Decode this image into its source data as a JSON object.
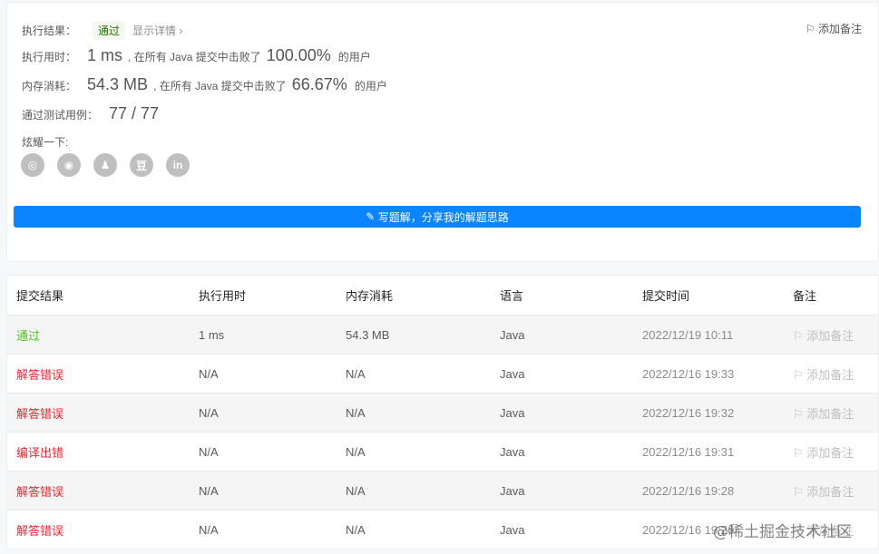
{
  "result": {
    "label": "执行结果：",
    "status": "通过",
    "detail": "显示详情 ›",
    "add_note": "添加备注"
  },
  "runtime": {
    "label": "执行用时：",
    "value": "1 ms",
    "mid": ", 在所有 Java 提交中击败了",
    "pct": "100.00%",
    "tail": "的用户"
  },
  "memory": {
    "label": "内存消耗：",
    "value": "54.3 MB",
    "mid": ", 在所有 Java 提交中击败了",
    "pct": "66.67%",
    "tail": "的用户"
  },
  "tests": {
    "label": "通过测试用例：",
    "value": "77 / 77"
  },
  "share": {
    "label": "炫耀一下:",
    "icons": [
      "wechat-icon",
      "weibo-icon",
      "qq-icon",
      "douban-icon",
      "linkedin-icon"
    ],
    "button": "写题解，分享我的解题思路"
  },
  "table": {
    "headers": [
      "提交结果",
      "执行用时",
      "内存消耗",
      "语言",
      "提交时间",
      "备注"
    ],
    "rows": [
      {
        "status": "通过",
        "ok": true,
        "time": "1 ms",
        "mem": "54.3 MB",
        "lang": "Java",
        "date": "2022/12/19 10:11",
        "note": "添加备注"
      },
      {
        "status": "解答错误",
        "ok": false,
        "time": "N/A",
        "mem": "N/A",
        "lang": "Java",
        "date": "2022/12/16 19:33",
        "note": "添加备注"
      },
      {
        "status": "解答错误",
        "ok": false,
        "time": "N/A",
        "mem": "N/A",
        "lang": "Java",
        "date": "2022/12/16 19:32",
        "note": "添加备注"
      },
      {
        "status": "编译出错",
        "ok": false,
        "time": "N/A",
        "mem": "N/A",
        "lang": "Java",
        "date": "2022/12/16 19:31",
        "note": "添加备注"
      },
      {
        "status": "解答错误",
        "ok": false,
        "time": "N/A",
        "mem": "N/A",
        "lang": "Java",
        "date": "2022/12/16 19:28",
        "note": "添加备注"
      },
      {
        "status": "解答错误",
        "ok": false,
        "time": "N/A",
        "mem": "N/A",
        "lang": "Java",
        "date": "2022/12/16 19:26",
        "note": "添加备注"
      }
    ]
  },
  "watermark": "@稀土掘金技术社区"
}
